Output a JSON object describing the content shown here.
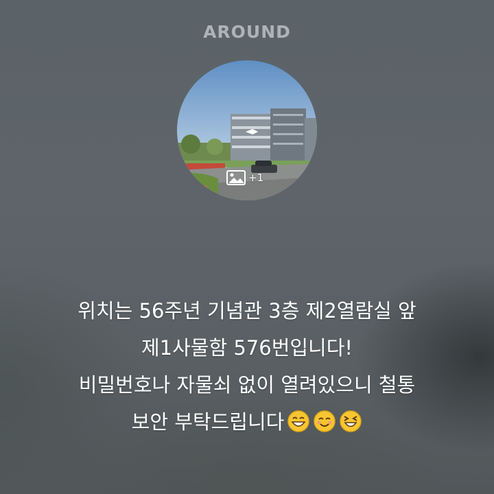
{
  "app": {
    "brand": "AROUND"
  },
  "post": {
    "photo": {
      "extra_count": "+1",
      "icon": "image-icon"
    },
    "caption_lines": [
      "위치는 56주년 기념관 3층 제2열람실 앞",
      "제1사물함 576번입니다!",
      "비밀번호나 자물쇠 없이 열려있으니 철통",
      "보안 부탁드립니다"
    ],
    "emojis": [
      "grinning-emoji",
      "smiling-emoji",
      "laughing-emoji"
    ]
  }
}
